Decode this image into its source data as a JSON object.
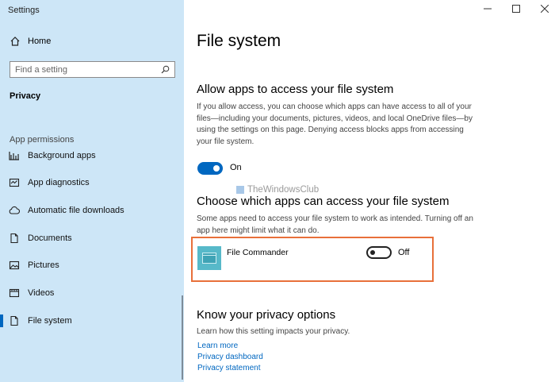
{
  "window": {
    "title": "Settings"
  },
  "sidebar": {
    "home_label": "Home",
    "search_placeholder": "Find a setting",
    "current_section": "Privacy",
    "group_label": "App permissions",
    "items": [
      {
        "label": "Background apps",
        "icon": "background-apps-icon"
      },
      {
        "label": "App diagnostics",
        "icon": "app-diagnostics-icon"
      },
      {
        "label": "Automatic file downloads",
        "icon": "cloud-download-icon"
      },
      {
        "label": "Documents",
        "icon": "document-icon"
      },
      {
        "label": "Pictures",
        "icon": "pictures-icon"
      },
      {
        "label": "Videos",
        "icon": "videos-icon"
      },
      {
        "label": "File system",
        "icon": "file-system-icon",
        "active": true
      }
    ]
  },
  "main": {
    "page_title": "File system",
    "allow_section": {
      "heading": "Allow apps to access your file system",
      "description": "If you allow access, you can choose which apps can have access to all of your files—including your documents, pictures, videos, and local OneDrive files—by using the settings on this page. Denying access blocks apps from accessing your file system.",
      "toggle_state": "On"
    },
    "watermark": "TheWindowsClub",
    "choose_section": {
      "heading": "Choose which apps can access your file system",
      "description": "Some apps need to access your file system to work as intended. Turning off an app here might limit what it can do.",
      "apps": [
        {
          "name": "File Commander",
          "toggle_state": "Off"
        }
      ]
    },
    "privacy_section": {
      "heading": "Know your privacy options",
      "description": "Learn how this setting impacts your privacy.",
      "links": [
        "Learn more",
        "Privacy dashboard",
        "Privacy statement"
      ]
    }
  },
  "colors": {
    "sidebar_bg": "#cde6f7",
    "accent": "#0067c0",
    "highlight_border": "#e8703a",
    "app_tile": "#57b9c9"
  }
}
